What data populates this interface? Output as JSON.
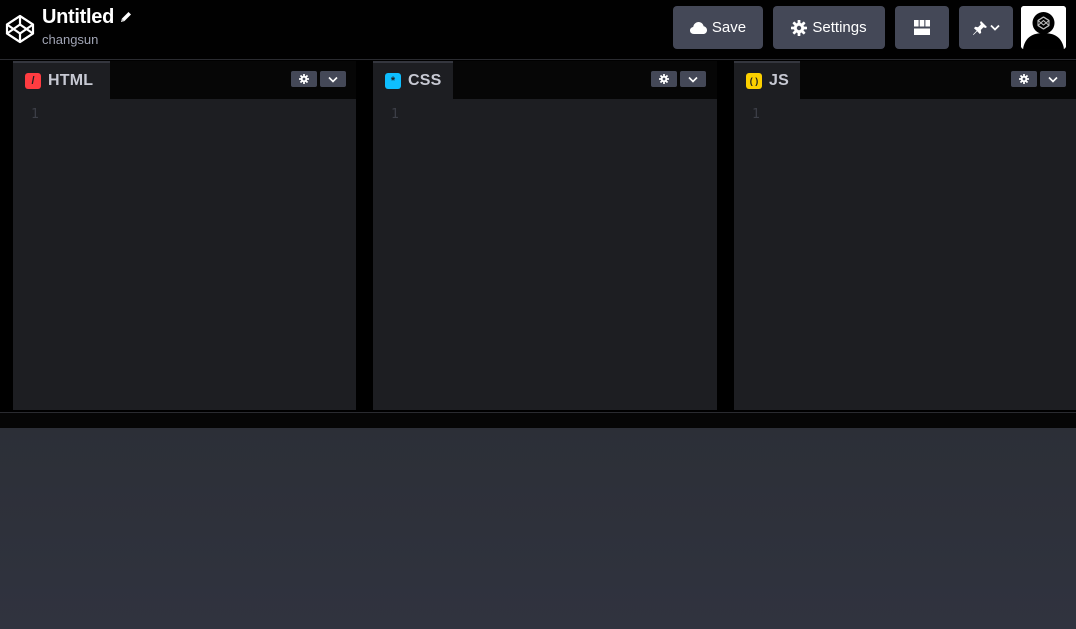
{
  "header": {
    "title": "Untitled",
    "owner": "changsun",
    "save_label": "Save",
    "settings_label": "Settings",
    "icons": {
      "logo": "codepen-logo-icon",
      "edit": "pencil-icon",
      "save": "cloud-icon",
      "settings": "gear-icon",
      "layout": "layout-grid-icon",
      "pin": "pin-icon",
      "pin_dropdown": "chevron-down-icon"
    }
  },
  "editors": [
    {
      "label": "HTML",
      "icon": "html-slash-icon",
      "icon_glyph": "/",
      "accent": "#ff3c41",
      "line_number": "1"
    },
    {
      "label": "CSS",
      "icon": "css-asterisk-icon",
      "icon_glyph": "*",
      "accent": "#0ebeff",
      "line_number": "1"
    },
    {
      "label": "JS",
      "icon": "js-parens-icon",
      "icon_glyph": "( )",
      "accent": "#fcd000",
      "line_number": "1"
    }
  ],
  "colors": {
    "topbar_bg": "#010101",
    "button_bg": "#444857",
    "editor_bg": "#1d1e22",
    "preview_bg": "#2f323c"
  }
}
